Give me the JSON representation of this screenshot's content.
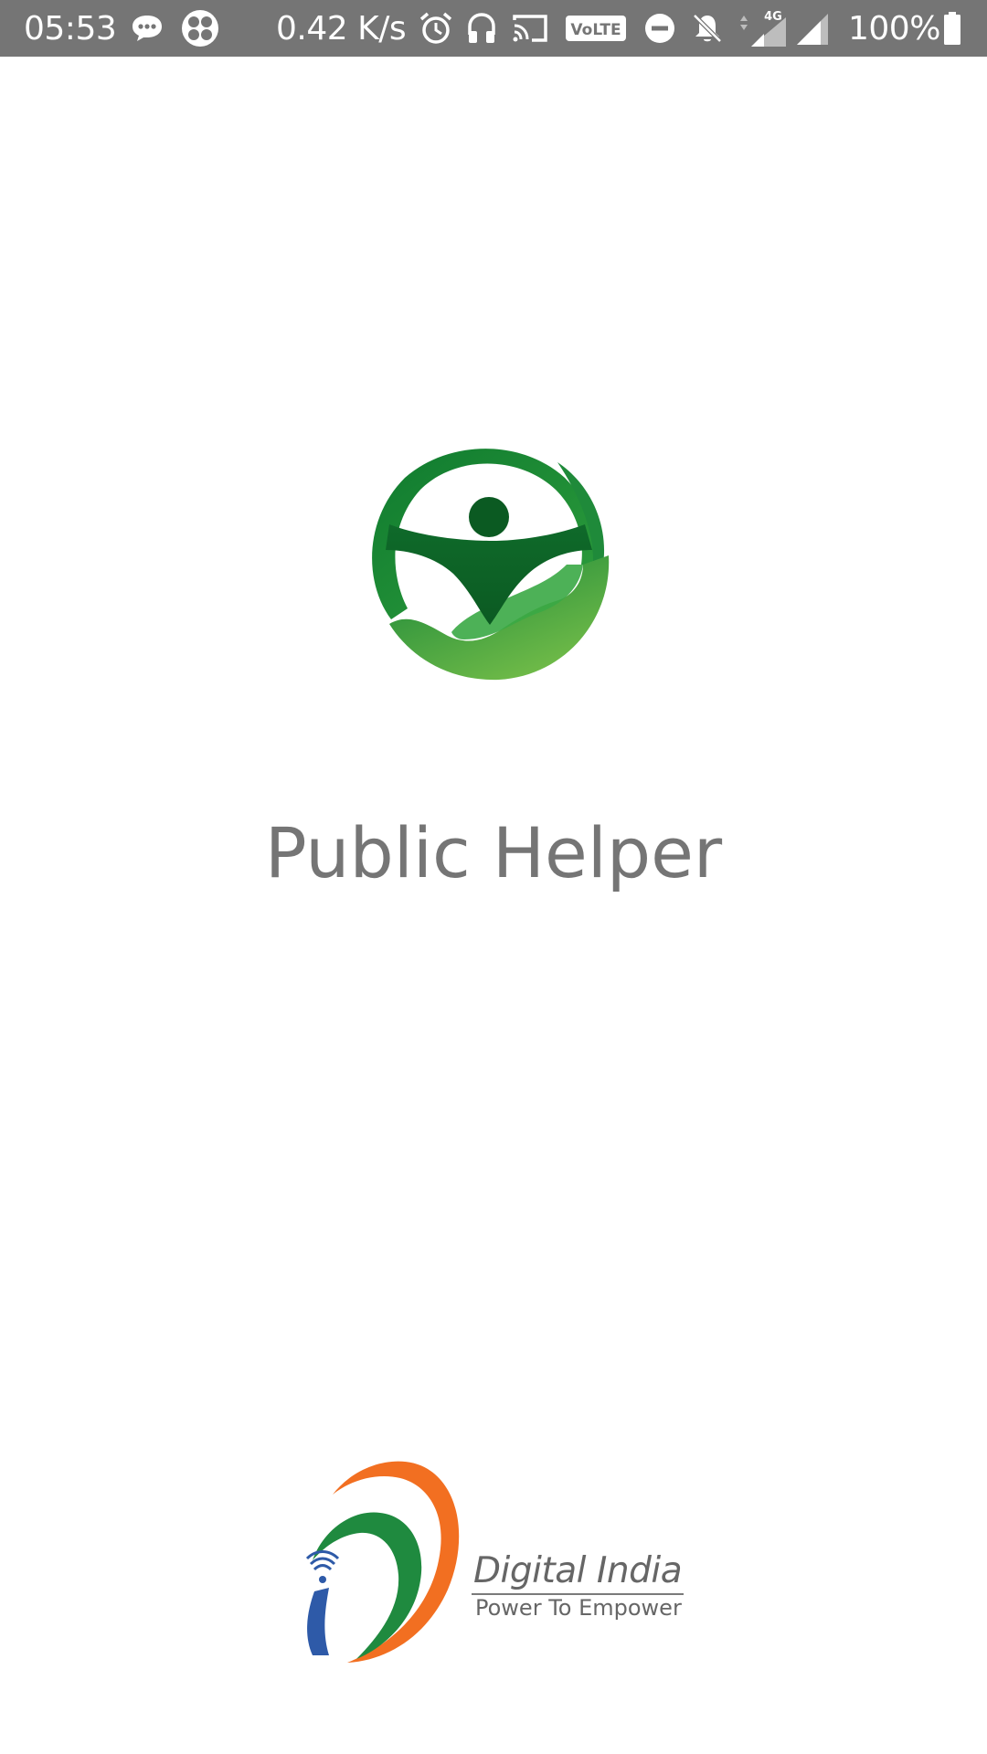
{
  "status_bar": {
    "time": "05:53",
    "network_speed": "0.42 K/s",
    "network_type": "4G",
    "volte_label": "VoLTE",
    "battery": "100%",
    "background": "#757575",
    "icons": [
      "chat-icon",
      "app-icon",
      "alarm-icon",
      "headset-icon",
      "cast-icon",
      "volte-icon",
      "do-not-disturb-icon",
      "notifications-off-icon",
      "signal-4g-icon",
      "signal-icon",
      "battery-icon"
    ]
  },
  "splash": {
    "app_name": "Public Helper",
    "logo_icon": "public-helper-logo",
    "logo_colors": [
      "#0f7a2f",
      "#2e9e3c",
      "#7cc24a"
    ]
  },
  "footer": {
    "brand": "Digital India",
    "tagline": "Power To Empower",
    "logo_icon": "digital-india-logo",
    "logo_colors": [
      "#f26f21",
      "#1f8a3f",
      "#2e5aa8"
    ]
  }
}
